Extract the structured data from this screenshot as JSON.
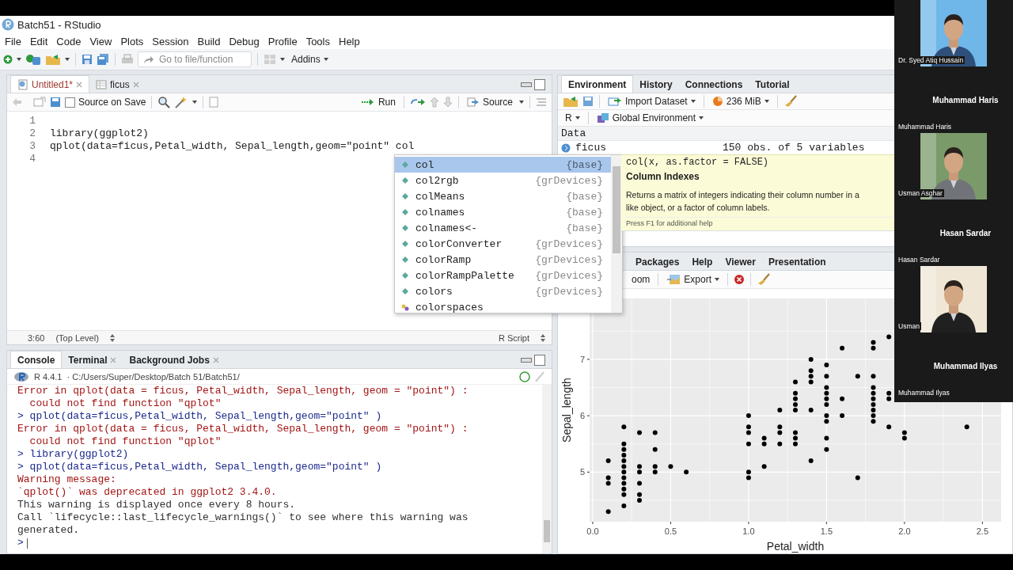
{
  "window": {
    "title": "Batch51 - RStudio"
  },
  "menu": [
    "File",
    "Edit",
    "Code",
    "View",
    "Plots",
    "Session",
    "Build",
    "Debug",
    "Profile",
    "Tools",
    "Help"
  ],
  "toolbar": {
    "goto_placeholder": "Go to file/function",
    "addins": "Addins"
  },
  "editor": {
    "tabs": [
      {
        "label": "Untitled1*",
        "selected": true,
        "kind": "script"
      },
      {
        "label": "ficus",
        "selected": false,
        "kind": "data"
      }
    ],
    "source_on_save": {
      "label": "Source on Save",
      "checked": false
    },
    "run": "Run",
    "source": "Source",
    "lines": [
      {
        "number": "1"
      },
      {
        "number": "2",
        "code": "library(ggplot2)"
      },
      {
        "number": "3",
        "code": "qplot(data=ficus,Petal_width, Sepal_length,geom=\"point\" col"
      },
      {
        "number": "4"
      }
    ],
    "position": "3:60",
    "scope": "(Top Level)",
    "filetype": "R Script"
  },
  "autocomplete": {
    "items": [
      {
        "name": "col",
        "package": "{base}",
        "kind": "function",
        "selected": true
      },
      {
        "name": "col2rgb",
        "package": "{grDevices}",
        "kind": "function",
        "selected": false
      },
      {
        "name": "colMeans",
        "package": "{base}",
        "kind": "function",
        "selected": false
      },
      {
        "name": "colnames",
        "package": "{base}",
        "kind": "function",
        "selected": false
      },
      {
        "name": "colnames<-",
        "package": "{base}",
        "kind": "function",
        "selected": false
      },
      {
        "name": "colorConverter",
        "package": "{grDevices}",
        "kind": "function",
        "selected": false
      },
      {
        "name": "colorRamp",
        "package": "{grDevices}",
        "kind": "function",
        "selected": false
      },
      {
        "name": "colorRampPalette",
        "package": "{grDevices}",
        "kind": "function",
        "selected": false
      },
      {
        "name": "colors",
        "package": "{grDevices}",
        "kind": "function",
        "selected": false
      },
      {
        "name": "colorspaces",
        "kind": "object",
        "selected": false
      }
    ]
  },
  "tooltip": {
    "signature": "col(x, as.factor = FALSE)",
    "title": "Column Indexes",
    "lines": [
      "Returns a matrix of integers indicating their column number in a",
      "like object, or a factor of column labels."
    ],
    "hint": "Press F1 for additional help"
  },
  "console": {
    "tabs": [
      {
        "label": "Console",
        "selected": true,
        "closable": false
      },
      {
        "label": "Terminal",
        "selected": false,
        "closable": true
      },
      {
        "label": "Background Jobs",
        "selected": false,
        "closable": true
      }
    ],
    "version": "R 4.4.1",
    "path": "· C:/Users/Super/Desktop/Batch 51/Batch51/",
    "lines": [
      {
        "kind": "error",
        "text": "Error in qplot(data = ficus, Petal_width, Sepal_length, geom = \"point\") :"
      },
      {
        "kind": "error",
        "text": "  could not find function \"qplot\""
      },
      {
        "kind": "command",
        "text": "> qplot(data=ficus,Petal_width, Sepal_length,geom=\"point\" )"
      },
      {
        "kind": "error",
        "text": "Error in qplot(data = ficus, Petal_width, Sepal_length, geom = \"point\") :"
      },
      {
        "kind": "error",
        "text": "  could not find function \"qplot\""
      },
      {
        "kind": "command",
        "text": "> library(ggplot2)"
      },
      {
        "kind": "command",
        "text": "> qplot(data=ficus,Petal_width, Sepal_length,geom=\"point\" )"
      },
      {
        "kind": "error",
        "text": "Warning message:"
      },
      {
        "kind": "error",
        "text": "`qplot()` was deprecated in ggplot2 3.4.0."
      },
      {
        "kind": "output",
        "text": "This warning is displayed once every 8 hours."
      },
      {
        "kind": "output",
        "text": "Call `lifecycle::last_lifecycle_warnings()` to see where this warning was"
      },
      {
        "kind": "output",
        "text": "generated."
      }
    ],
    "prompt": ">"
  },
  "environment": {
    "tabs": [
      {
        "label": "Environment",
        "selected": true
      },
      {
        "label": "History",
        "selected": false
      },
      {
        "label": "Connections",
        "selected": false
      },
      {
        "label": "Tutorial",
        "selected": false
      }
    ],
    "import": "Import Dataset",
    "memory": "236 MiB",
    "language": "R",
    "scope": "Global Environment",
    "section": "Data",
    "rows": [
      {
        "name": "ficus",
        "value": "150 obs. of 5 variables"
      }
    ]
  },
  "plots": {
    "tabs": [
      {
        "label": "Packages",
        "selected": false
      },
      {
        "label": "Help",
        "selected": false
      },
      {
        "label": "Viewer",
        "selected": false
      },
      {
        "label": "Presentation",
        "selected": false
      }
    ],
    "zoom": "oom",
    "export": "Export",
    "chart_data": {
      "type": "scatter",
      "xlabel": "Petal_width",
      "ylabel": "Sepal_length",
      "xlim": [
        -0.02,
        2.62
      ],
      "ylim": [
        4.12,
        8.08
      ],
      "xticks": [
        {
          "value": 0,
          "label": "0.0"
        },
        {
          "value": 0.5,
          "label": "0.5"
        },
        {
          "value": 1,
          "label": "1.0"
        },
        {
          "value": 1.5,
          "label": "1.5"
        },
        {
          "value": 2,
          "label": "2.0"
        },
        {
          "value": 2.5,
          "label": "2.5"
        }
      ],
      "yticks": [
        5,
        6,
        7
      ],
      "x": [
        0.1,
        0.1,
        0.1,
        0.1,
        0.2,
        0.2,
        0.2,
        0.2,
        0.2,
        0.2,
        0.2,
        0.2,
        0.2,
        0.2,
        0.2,
        0.2,
        0.3,
        0.3,
        0.3,
        0.3,
        0.3,
        0.3,
        0.4,
        0.4,
        0.4,
        0.4,
        0.5,
        0.6,
        1,
        1,
        1,
        1,
        1,
        1,
        1.1,
        1.1,
        1.1,
        1.2,
        1.2,
        1.2,
        1.2,
        1.3,
        1.3,
        1.3,
        1.3,
        1.3,
        1.3,
        1.3,
        1.3,
        1.4,
        1.4,
        1.4,
        1.4,
        1.4,
        1.4,
        1.5,
        1.5,
        1.5,
        1.5,
        1.5,
        1.5,
        1.5,
        1.5,
        1.5,
        1.5,
        1.6,
        1.6,
        1.6,
        1.7,
        1.7,
        1.8,
        1.8,
        1.8,
        1.8,
        1.8,
        1.8,
        1.8,
        1.8,
        1.8,
        1.8,
        1.9,
        1.9,
        1.9,
        1.9,
        2,
        2,
        2.4
      ],
      "grid": true,
      "series": [
        {
          "color": "#000000",
          "values": [
            5.2,
            4.9,
            4.8,
            4.3,
            5.8,
            5.5,
            5.4,
            5.3,
            5.2,
            5.1,
            5.0,
            4.9,
            4.8,
            4.7,
            4.6,
            4.4,
            5.7,
            5.1,
            5.0,
            4.8,
            4.6,
            4.5,
            5.7,
            5.4,
            5.1,
            5.0,
            5.1,
            5.0,
            6.0,
            5.8,
            5.7,
            5.5,
            5.0,
            4.9,
            5.6,
            5.5,
            5.1,
            6.1,
            5.8,
            5.7,
            5.5,
            6.6,
            6.4,
            6.3,
            6.2,
            6.1,
            5.7,
            5.6,
            5.5,
            7.0,
            6.8,
            6.7,
            6.6,
            6.1,
            5.2,
            6.9,
            6.7,
            6.5,
            6.4,
            6.3,
            6.2,
            6.0,
            5.9,
            5.6,
            5.4,
            7.2,
            6.3,
            6.0,
            6.7,
            4.9,
            7.3,
            7.2,
            6.7,
            6.5,
            6.4,
            6.3,
            6.2,
            6.1,
            6.0,
            5.9,
            7.4,
            6.4,
            6.3,
            5.8,
            5.7,
            5.6,
            5.8
          ]
        }
      ]
    }
  },
  "participants": [
    {
      "kind": "video",
      "name": "Dr. Syed Atiq Hussain"
    },
    {
      "kind": "avatar",
      "display": "Muhammad Haris",
      "name": "Muhammad Haris"
    },
    {
      "kind": "video",
      "name": "Usman Asghar"
    },
    {
      "kind": "avatar",
      "display": "Hasan Sardar",
      "name": "Hasan Sardar"
    },
    {
      "kind": "video",
      "name": "Usman"
    },
    {
      "kind": "avatar",
      "display": "Muhammad Ilyas",
      "name": "Muhammad Ilyas"
    }
  ]
}
